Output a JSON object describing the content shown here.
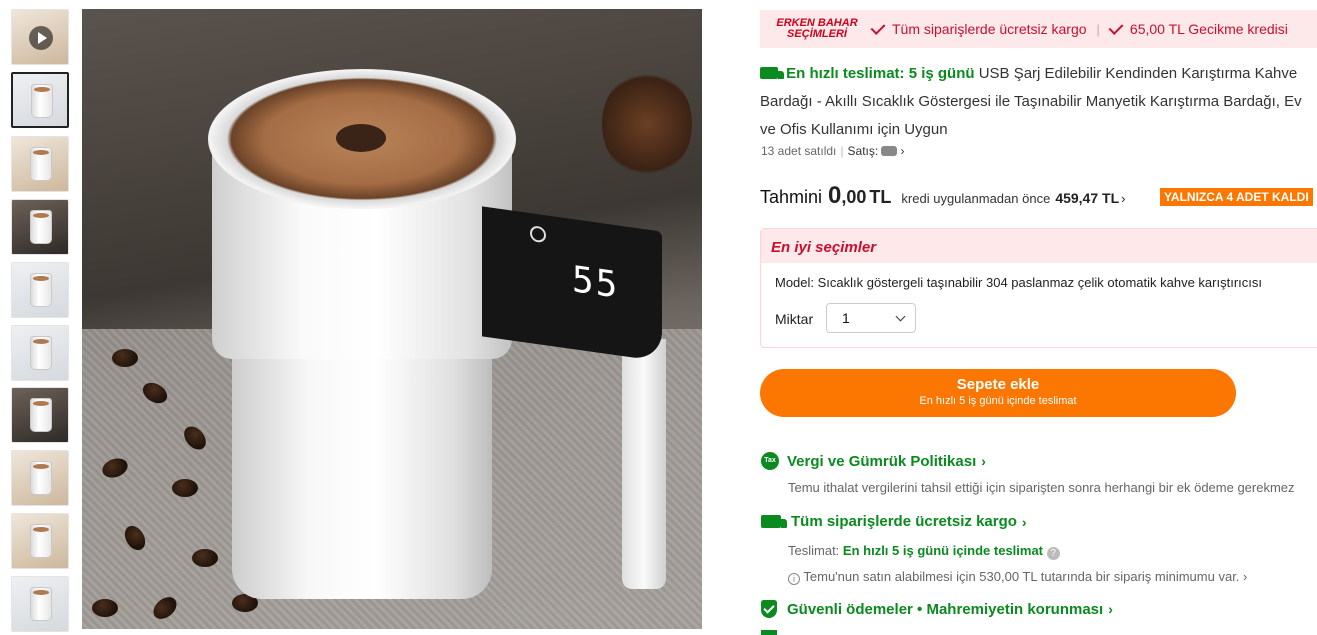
{
  "thumbnails": [
    {
      "type": "video",
      "active": false
    },
    {
      "type": "image",
      "active": true
    },
    {
      "type": "image",
      "active": false
    },
    {
      "type": "image",
      "active": false
    },
    {
      "type": "image",
      "active": false
    },
    {
      "type": "image",
      "active": false
    },
    {
      "type": "image",
      "active": false
    },
    {
      "type": "image",
      "active": false
    },
    {
      "type": "image",
      "active": false
    },
    {
      "type": "image",
      "active": false
    }
  ],
  "main_image": {
    "display_digits": "55"
  },
  "promo": {
    "badge_line1": "ERKEN BAHAR",
    "badge_line2": "SEÇİMLERİ",
    "free_shipping": "Tüm siparişlerde ücretsiz kargo",
    "separator": "|",
    "delay_credit": "65,00 TL Gecikme kredisi"
  },
  "product": {
    "fast_delivery": "En hızlı teslimat: 5 iş günü",
    "title": "USB Şarj Edilebilir Kendinden Karıştırma Kahve Bardağı - Akıllı Sıcaklık Göstergesi ile Taşınabilir Manyetik Karıştırma Bardağı, Ev ve Ofis Kullanımı için Uygun",
    "sold": "13 adet satıldı",
    "seller_label": "Satış:"
  },
  "price": {
    "estimated_label": "Tahmini",
    "amount_main": "0",
    "amount_decimal": ",00",
    "currency": "TL",
    "credit_text": "kredi uygulanmadan önce",
    "original_price": "459,47 TL",
    "stock_badge": "YALNIZCA 4 ADET KALDI"
  },
  "best_choices": {
    "heading": "En iyi seçimler",
    "model_text": "Model: Sıcaklık göstergeli taşınabilir 304 paslanmaz çelik otomatik kahve karıştırıcısı",
    "quantity_label": "Miktar",
    "quantity_value": "1"
  },
  "cart_button": {
    "label": "Sepete ekle",
    "sublabel": "En hızlı 5 iş günü içinde teslimat"
  },
  "info": {
    "tax_icon_text": "Tax",
    "tax_heading": "Vergi ve Gümrük Politikası",
    "tax_text": "Temu ithalat vergilerini tahsil ettiği için siparişten sonra herhangi bir ek ödeme gerekmez",
    "shipping_heading": "Tüm siparişlerde ücretsiz kargo",
    "delivery_label": "Teslimat:",
    "delivery_value": "En hızlı 5 iş günü içinde teslimat",
    "minimum_text": "Temu'nun satın alabilmesi için 530,00 TL tutarında bir sipariş minimumu var.",
    "secure_heading": "Güvenli ödemeler • Mahremiyetin korunması"
  },
  "colors": {
    "accent_orange": "#fb7701",
    "promo_red": "#c8102e",
    "promo_bg": "#fde8ea",
    "success_green": "#0a8a1f"
  }
}
